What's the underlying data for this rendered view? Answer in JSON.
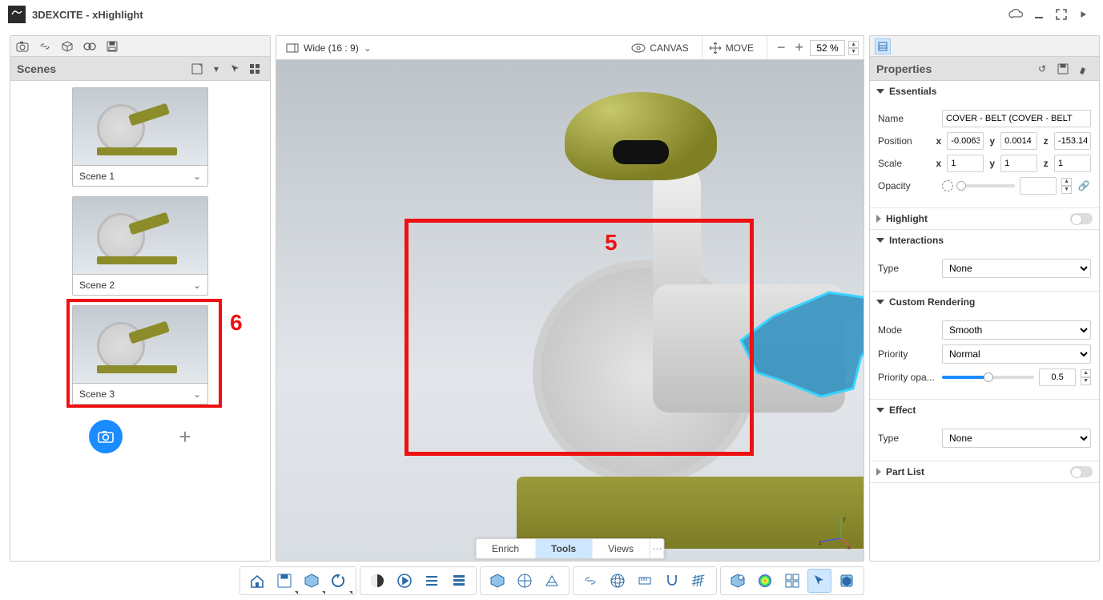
{
  "window": {
    "title": "3DEXCITE - xHighlight"
  },
  "scenes": {
    "panel_title": "Scenes",
    "items": [
      {
        "name": "Scene 1"
      },
      {
        "name": "Scene 2"
      },
      {
        "name": "Scene 3"
      }
    ],
    "annotation_6": "6",
    "annotation_5": "5"
  },
  "canvas": {
    "aspect_label": "Wide (16 : 9)",
    "canvas_btn": "CANVAS",
    "move_btn": "MOVE",
    "zoom_pct": "52 %"
  },
  "tabs": {
    "enrich": "Enrich",
    "tools": "Tools",
    "views": "Views"
  },
  "properties": {
    "panel_title": "Properties",
    "essentials": {
      "title": "Essentials",
      "name_label": "Name",
      "name_value": "COVER - BELT (COVER - BELT",
      "position_label": "Position",
      "x": "-0.0063",
      "y": "0.0014",
      "z": "-153.14",
      "scale_label": "Scale",
      "sx": "1",
      "sy": "1",
      "sz": "1",
      "opacity_label": "Opacity",
      "opacity_value": ""
    },
    "highlight": {
      "title": "Highlight"
    },
    "interactions": {
      "title": "Interactions",
      "type_label": "Type",
      "type_value": "None"
    },
    "custom_rendering": {
      "title": "Custom Rendering",
      "mode_label": "Mode",
      "mode_value": "Smooth",
      "priority_label": "Priority",
      "priority_value": "Normal",
      "priority_opa_label": "Priority opa...",
      "priority_opa_value": "0.5"
    },
    "effect": {
      "title": "Effect",
      "type_label": "Type",
      "type_value": "None"
    },
    "partlist": {
      "title": "Part List"
    },
    "axis_labels": {
      "x": "x",
      "y": "y",
      "z": "z"
    }
  },
  "icons": {
    "camera": "camera",
    "link": "link",
    "box": "box",
    "swap": "swap",
    "save": "save",
    "cloud": "cloud",
    "min": "minimize",
    "full": "fullscreen",
    "more": "more"
  }
}
